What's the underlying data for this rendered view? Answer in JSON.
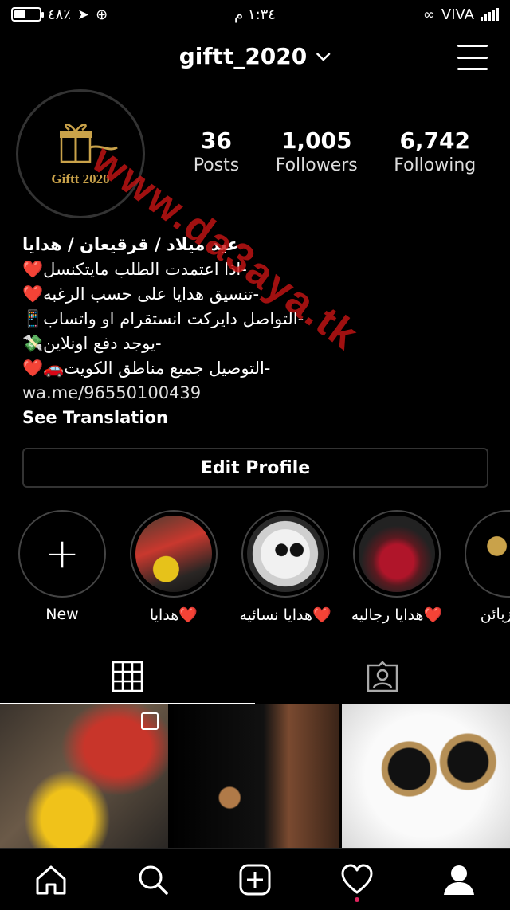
{
  "status_bar": {
    "battery_pct": "٤٨٪",
    "battery_level": 0.48,
    "time": "١:٣٤ م",
    "carrier": "VIVA"
  },
  "header": {
    "username": "giftt_2020"
  },
  "watermark": "www.da3aya.tk",
  "profile": {
    "avatar_text": "Giftt 2020",
    "stats": [
      {
        "value": "36",
        "label": "Posts"
      },
      {
        "value": "1,005",
        "label": "Followers"
      },
      {
        "value": "6,742",
        "label": "Following"
      }
    ],
    "bio": {
      "name": "عيد ميلاد / قرقيعان / هدايا",
      "lines": [
        "-اذا اعتمدت الطلب مايتكنسل❤️",
        "-تنسيق هدايا على حسب الرغبه❤️",
        "-التواصل دايركت انستقرام او واتساب📱",
        "-يوجد دفع اونلاين💸",
        "-التوصيل جميع مناطق الكويت🚗❤️"
      ],
      "link": "wa.me/96550100439",
      "see_translation": "See Translation"
    },
    "edit_profile_label": "Edit Profile"
  },
  "highlights": [
    {
      "label": "New"
    },
    {
      "label": "هدايا❤️"
    },
    {
      "label": "هدايا نسائيه❤️"
    },
    {
      "label": "هدايا رجاليه❤️"
    },
    {
      "label": "الزبائن..."
    }
  ],
  "colors": {
    "background": "#000000",
    "accent_gold": "#c9a24a",
    "watermark_red": "#c81414",
    "notification_dot": "#e0245e"
  },
  "icons": {
    "grid_tab": "grid-icon",
    "tagged_tab": "tagged-icon",
    "nav": [
      "home-icon",
      "search-icon",
      "add-post-icon",
      "heart-icon",
      "profile-icon"
    ]
  }
}
